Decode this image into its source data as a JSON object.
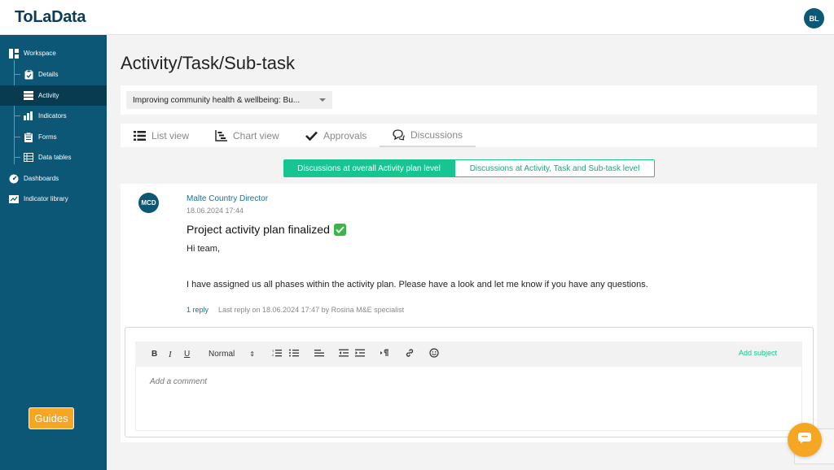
{
  "app": {
    "logo_text": "ToLaData",
    "user_initials": "BL"
  },
  "sidebar": {
    "items": [
      {
        "label": "Workspace",
        "icon": "workspace-icon"
      },
      {
        "label": "Details",
        "icon": "clipboard-icon"
      },
      {
        "label": "Activity",
        "icon": "activity-list-icon",
        "active": true
      },
      {
        "label": "Indicators",
        "icon": "bar-chart-icon"
      },
      {
        "label": "Forms",
        "icon": "form-icon"
      },
      {
        "label": "Data tables",
        "icon": "table-icon"
      },
      {
        "label": "Dashboards",
        "icon": "dashboard-icon"
      },
      {
        "label": "Indicator library",
        "icon": "library-icon"
      }
    ],
    "guides_label": "Guides"
  },
  "main": {
    "page_title": "Activity/Task/Sub-task",
    "plan_selector": {
      "selected": "Improving community health & wellbeing: Bu..."
    },
    "tabs": [
      {
        "label": "List view",
        "icon": "list-icon"
      },
      {
        "label": "Chart view",
        "icon": "chart-icon"
      },
      {
        "label": "Approvals",
        "icon": "checkmark-icon"
      },
      {
        "label": "Discussions",
        "icon": "discussion-icon",
        "active": true
      }
    ],
    "discussion_toggle": {
      "option_a": "Discussions at overall Activity plan level",
      "option_b": "Discussions at Activity, Task and Sub-task level",
      "selected": "option_a"
    }
  },
  "discussion": {
    "author_initials": "MCD",
    "author": "Malte Country Director",
    "date": "18.06.2024 17:44",
    "subject": "Project activity plan finalized",
    "subject_emoji": "check-mark-button-emoji",
    "body_greeting": "Hi team,",
    "body_text": "I have assigned us all phases within the activity plan. Please have a look and let me know if you have any questions.",
    "replies_label": "1 reply",
    "last_reply": "Last reply on 18.06.2024 17:47 by Rosina M&E specialist"
  },
  "editor": {
    "bold_label": "B",
    "italic_label": "I",
    "underline_label": "U",
    "style_select": "Normal",
    "add_subject_label": "Add subject",
    "placeholder": "Add a comment"
  },
  "colors": {
    "brand": "#0c5676",
    "accent_green": "#16c58f",
    "guides_orange": "#f5a623"
  }
}
